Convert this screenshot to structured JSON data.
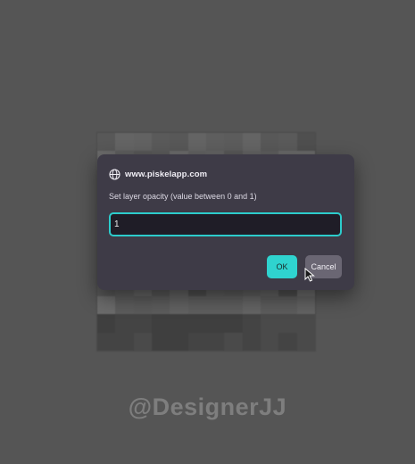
{
  "dialog": {
    "origin": "www.piskelapp.com",
    "message": "Set layer opacity (value between 0 and 1)",
    "input_value": "1",
    "ok_label": "OK",
    "cancel_label": "Cancel"
  },
  "watermark": {
    "text": "@DesignerJJ"
  },
  "colors": {
    "background": "#555555",
    "dialog_bg": "#3e3b47",
    "accent": "#2fd3cf",
    "cancel_bg": "#6a6673",
    "input_bg": "#1f1d27"
  },
  "icons": {
    "origin": "globe-icon",
    "pointer": "cursor-icon"
  }
}
